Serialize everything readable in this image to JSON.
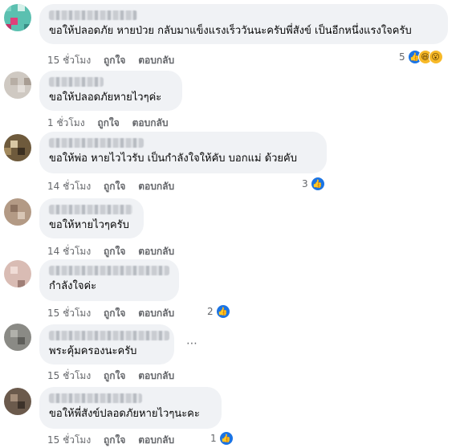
{
  "comments": [
    {
      "text": "ขอให้ปลอดภัย หายป่วย กลับมาแข็งแรงเร็ววันนะครับพี่สังข์ เป็นอีกหนึ่งแรงใจครับ",
      "time": "15 ชั่วโมง",
      "like": "ถูกใจ",
      "reply": "ตอบกลับ",
      "reactions": "5"
    },
    {
      "text": "ขอให้ปลอดภัยหายไวๆค่ะ",
      "time": "1 ชั่วโมง",
      "like": "ถูกใจ",
      "reply": "ตอบกลับ",
      "reactions": ""
    },
    {
      "text": "ขอให้พ่อ หายไวไวรับ เป็นกำลังใจให้คับ บอกแม่ ด้วยคับ",
      "time": "14 ชั่วโมง",
      "like": "ถูกใจ",
      "reply": "ตอบกลับ",
      "reactions": "3"
    },
    {
      "text": "ขอให้หายไวๆครับ",
      "time": "14 ชั่วโมง",
      "like": "ถูกใจ",
      "reply": "ตอบกลับ",
      "reactions": ""
    },
    {
      "text": "กำลังใจค่ะ",
      "time": "15 ชั่วโมง",
      "like": "ถูกใจ",
      "reply": "ตอบกลับ",
      "reactions": "2"
    },
    {
      "text": "พระคุ้มครองนะครับ",
      "time": "15 ชั่วโมง",
      "like": "ถูกใจ",
      "reply": "ตอบกลับ",
      "reactions": ""
    },
    {
      "text": "ขอให้พี่สังข์ปลอดภัยหายไวๆนะคะ",
      "time": "15 ชั่วโมง",
      "like": "ถูกใจ",
      "reply": "ตอบกลับ",
      "reactions": "1"
    }
  ],
  "icons": {
    "like": "like-reaction-icon",
    "haha": "haha-reaction-icon",
    "wow": "wow-reaction-icon",
    "more": "more-options-icon"
  },
  "colors": {
    "bubble": "#f0f2f5",
    "meta": "#65676b",
    "like_blue": "#1b74e4"
  }
}
